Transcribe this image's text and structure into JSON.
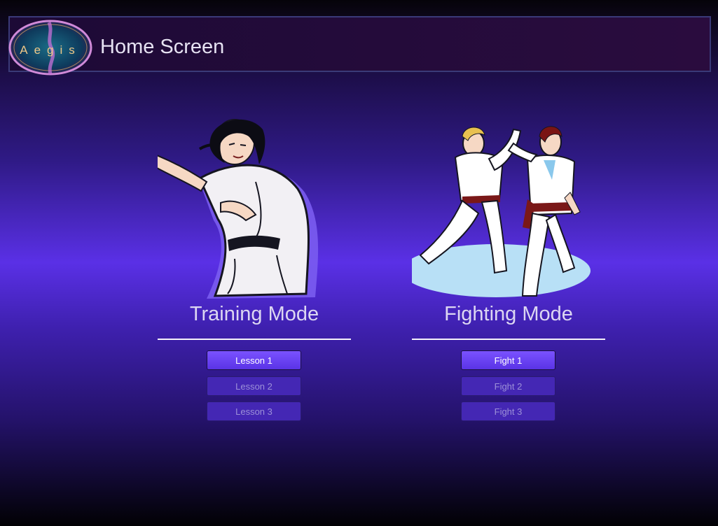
{
  "header": {
    "title": "Home Screen",
    "logo_text": "Aegis"
  },
  "modes": [
    {
      "title": "Training Mode",
      "image_icon": "karate-stance-illustration",
      "buttons": [
        {
          "label": "Lesson 1",
          "state": "active"
        },
        {
          "label": "Lesson 2",
          "state": "inactive"
        },
        {
          "label": "Lesson 3",
          "state": "inactive"
        }
      ]
    },
    {
      "title": "Fighting Mode",
      "image_icon": "karate-sparring-illustration",
      "buttons": [
        {
          "label": "Fight 1",
          "state": "active"
        },
        {
          "label": "Fight 2",
          "state": "inactive"
        },
        {
          "label": "Fight 3",
          "state": "inactive"
        }
      ]
    }
  ],
  "colors": {
    "accent": "#6a42f4",
    "background_mid": "#5a30e6",
    "header_bg": "#240b3a",
    "button_active": "#7a52ff",
    "button_inactive": "#4427b4"
  }
}
